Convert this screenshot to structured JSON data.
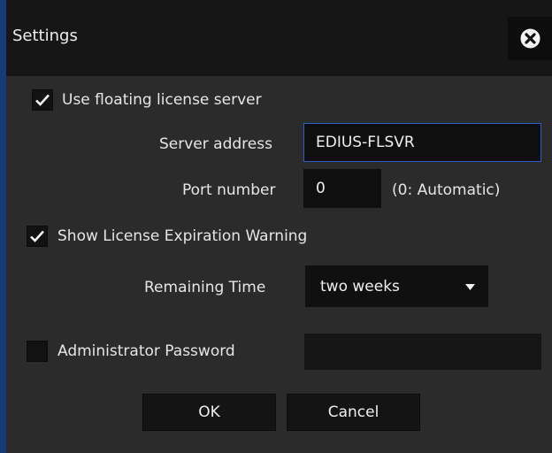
{
  "window": {
    "title": "Settings",
    "close_icon": "close-circle-x-icon"
  },
  "license": {
    "use_floating_label": "Use floating license server",
    "use_floating_checked": true,
    "server_address_label": "Server address",
    "server_address_value": "EDIUS-FLSVR",
    "port_number_label": "Port number",
    "port_number_value": "0",
    "port_hint": "(0: Automatic)"
  },
  "expiration": {
    "show_warning_label": "Show License Expiration Warning",
    "show_warning_checked": true,
    "remaining_time_label": "Remaining Time",
    "remaining_time_value": "two weeks"
  },
  "admin": {
    "password_label": "Administrator Password",
    "password_checked": false,
    "password_value": ""
  },
  "buttons": {
    "ok_label": "OK",
    "cancel_label": "Cancel"
  },
  "colors": {
    "window_frame": "#173b7a",
    "dialog_background": "#2b2b2b",
    "focus_border": "#2a5fcf"
  }
}
